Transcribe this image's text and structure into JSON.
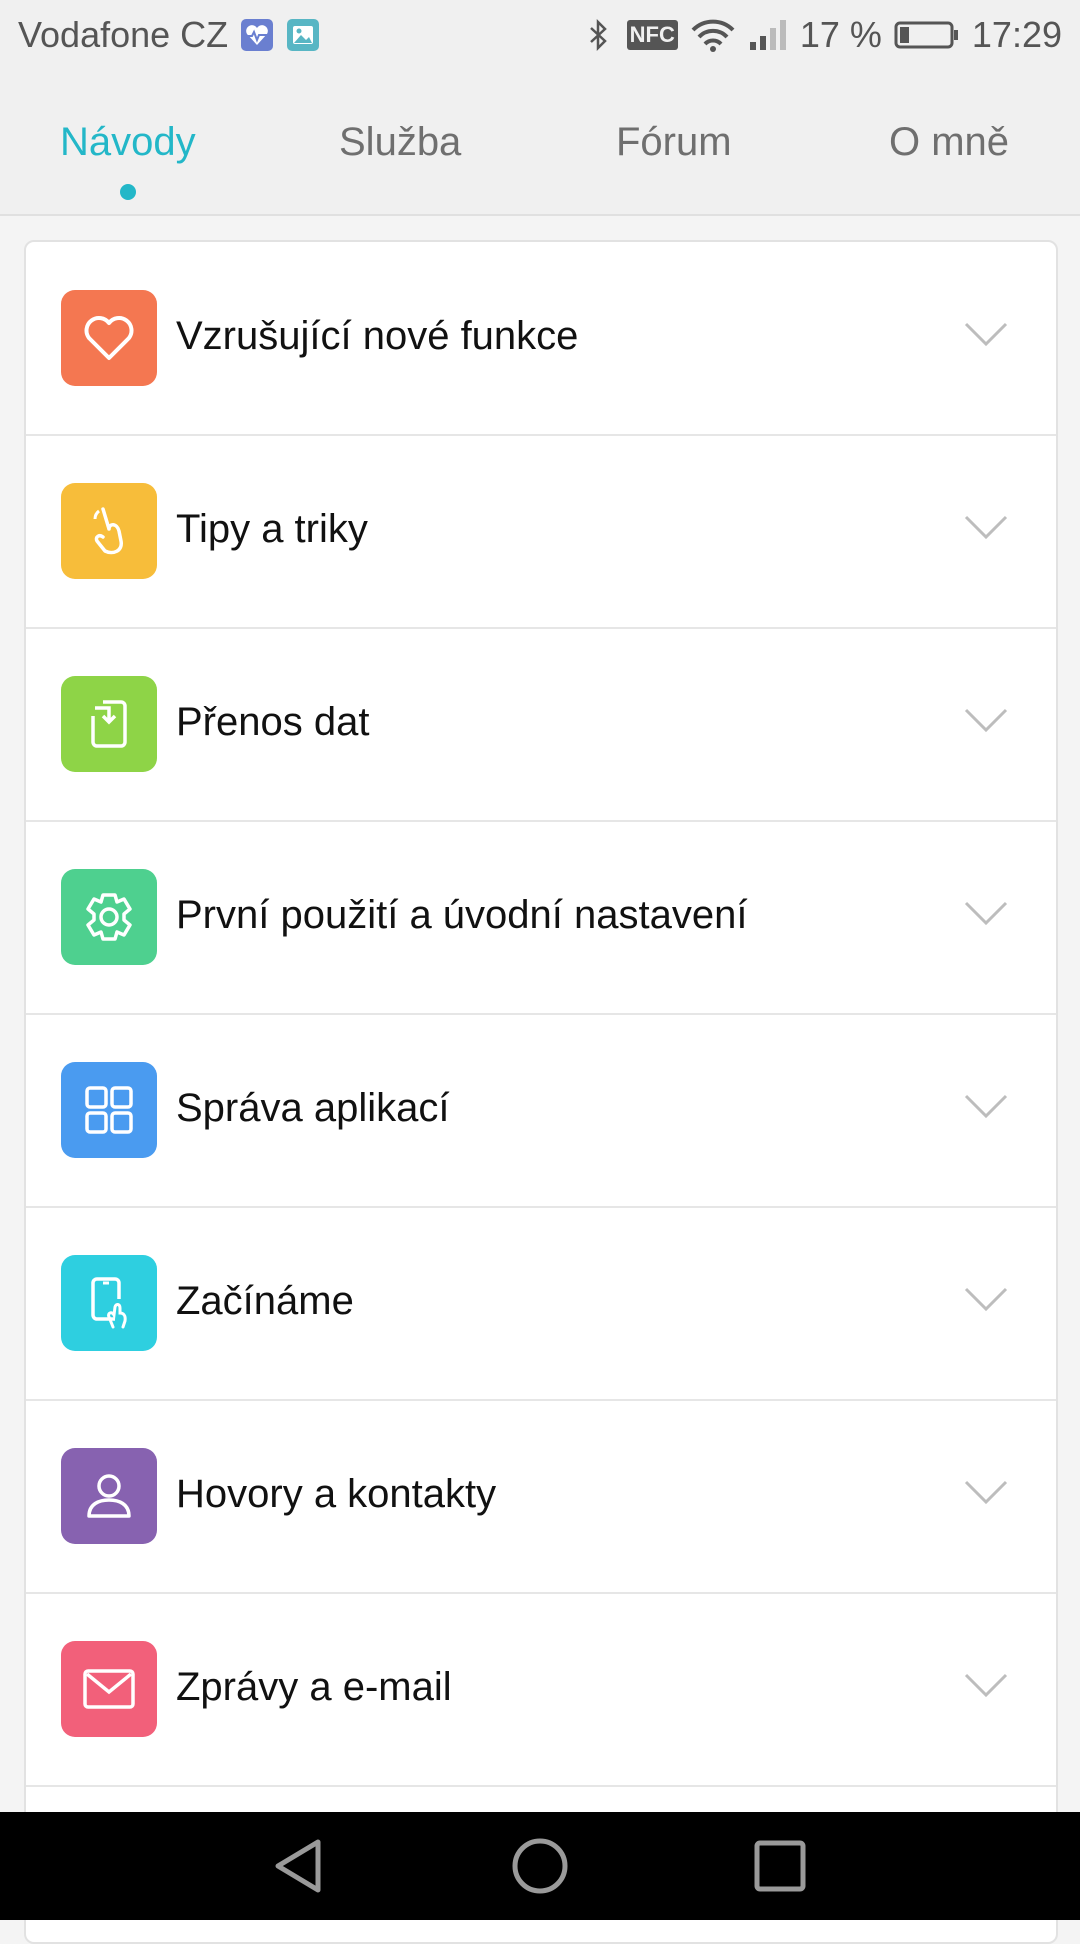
{
  "status_bar": {
    "carrier": "Vodafone CZ",
    "nfc": "NFC",
    "battery_percent": "17 %",
    "time": "17:29",
    "icons": [
      "health-notification-icon",
      "gallery-notification-icon",
      "bluetooth-icon",
      "nfc-icon",
      "wifi-icon",
      "signal-icon",
      "battery-icon"
    ]
  },
  "tabs": [
    {
      "label": "Návody",
      "active": true
    },
    {
      "label": "Služba",
      "active": false
    },
    {
      "label": "Fórum",
      "active": false
    },
    {
      "label": "O mně",
      "active": false
    }
  ],
  "sections": [
    {
      "label": "Vzrušující nové funkce",
      "icon": "heart-icon",
      "color": "#f47751"
    },
    {
      "label": "Tipy a triky",
      "icon": "gesture-hand-icon",
      "color": "#f7bd3a"
    },
    {
      "label": "Přenos dat",
      "icon": "data-transfer-icon",
      "color": "#8ed447"
    },
    {
      "label": "První použití a úvodní nastavení",
      "icon": "gear-icon",
      "color": "#4ed08f"
    },
    {
      "label": "Správa aplikací",
      "icon": "apps-grid-icon",
      "color": "#4a9bf0"
    },
    {
      "label": "Začínáme",
      "icon": "phone-touch-icon",
      "color": "#2ecfe0"
    },
    {
      "label": "Hovory a kontakty",
      "icon": "contact-person-icon",
      "color": "#8762b0"
    },
    {
      "label": "Zprávy a e-mail",
      "icon": "mail-icon",
      "color": "#f2607a"
    }
  ],
  "nav": [
    "back-icon",
    "home-icon",
    "recents-icon"
  ]
}
